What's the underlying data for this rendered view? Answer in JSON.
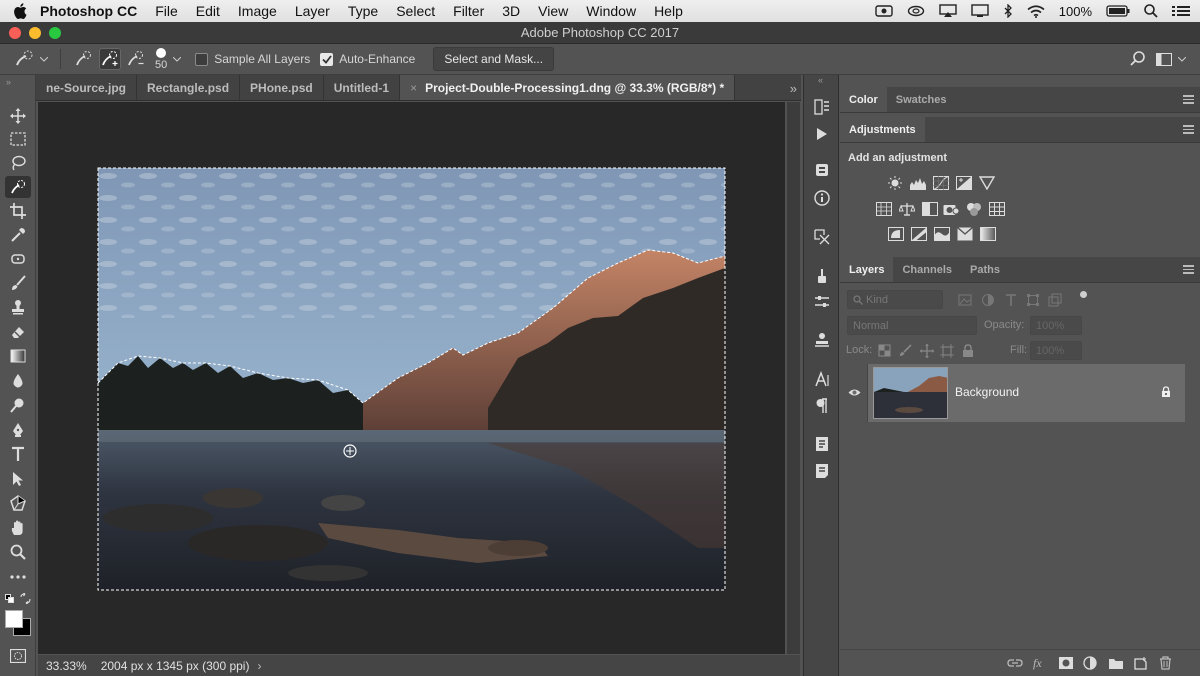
{
  "menubar": {
    "app_name": "Photoshop CC",
    "items": [
      "File",
      "Edit",
      "Image",
      "Layer",
      "Type",
      "Select",
      "Filter",
      "3D",
      "View",
      "Window",
      "Help"
    ],
    "battery": "100%"
  },
  "window": {
    "title": "Adobe Photoshop CC 2017"
  },
  "options": {
    "brush_size": "50",
    "sample_all_layers": "Sample All Layers",
    "auto_enhance": "Auto-Enhance",
    "select_and_mask": "Select and Mask..."
  },
  "doc_tabs": [
    {
      "label": "ne-Source.jpg"
    },
    {
      "label": "Rectangle.psd"
    },
    {
      "label": "PHone.psd"
    },
    {
      "label": "Untitled-1"
    },
    {
      "label": "Project-Double-Processing1.dng @ 33.3% (RGB/8*) *"
    }
  ],
  "status": {
    "zoom": "33.33%",
    "doc_info": "2004 px x 1345 px (300 ppi)"
  },
  "color_panel": {
    "tabs": [
      "Color",
      "Swatches"
    ]
  },
  "adjustments_panel": {
    "tab": "Adjustments",
    "heading": "Add an adjustment"
  },
  "layers_panel": {
    "tabs": [
      "Layers",
      "Channels",
      "Paths"
    ],
    "kind_placeholder": "Kind",
    "blend_mode": "Normal",
    "opacity_label": "Opacity:",
    "opacity_value": "100%",
    "lock_label": "Lock:",
    "fill_label": "Fill:",
    "fill_value": "100%",
    "layers": [
      {
        "name": "Background",
        "locked": true,
        "visible": true
      }
    ]
  },
  "colors": {
    "accent_bg": "#535353",
    "dark_bg": "#282828",
    "panel_header": "#464646"
  }
}
